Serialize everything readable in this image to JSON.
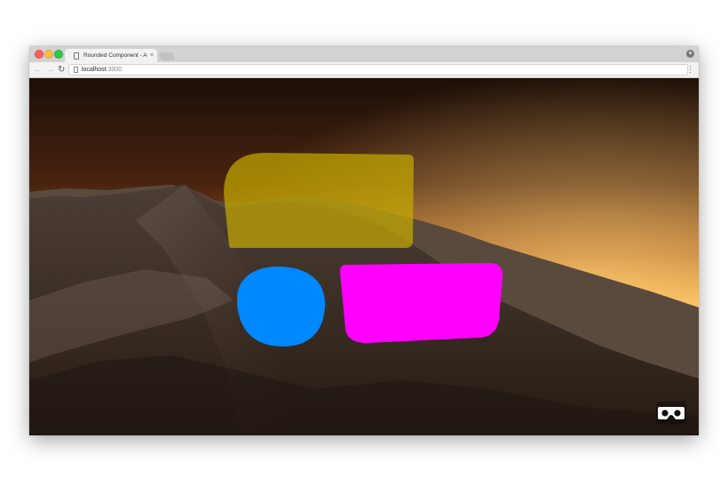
{
  "browser": {
    "tab": {
      "title": "Rounded Component - A-Fram",
      "close_glyph": "×",
      "icon": "page-icon"
    },
    "nav": {
      "back_glyph": "←",
      "forward_glyph": "→",
      "reload_glyph": "↻"
    },
    "address": {
      "host": "localhost",
      "port": ":3000"
    },
    "menu_glyph": "⋮",
    "traffic_light_colors": {
      "close": "#fc605c",
      "minimize": "#fdbc40",
      "maximize": "#34c84a"
    }
  },
  "scene": {
    "panels": [
      {
        "name": "yellow-rounded-panel",
        "color": "#c8ac00",
        "opacity": 0.7
      },
      {
        "name": "blue-rounded-panel",
        "color": "#0088ff",
        "opacity": 1
      },
      {
        "name": "magenta-rounded-panel",
        "color": "#ff00ff",
        "opacity": 1
      }
    ],
    "sky_colors": {
      "top": "#201008",
      "horizon": "#f0a040",
      "ground": "#2e2218"
    }
  },
  "vr_button": {
    "icon": "vr-headset-icon",
    "label": "Enter VR"
  }
}
